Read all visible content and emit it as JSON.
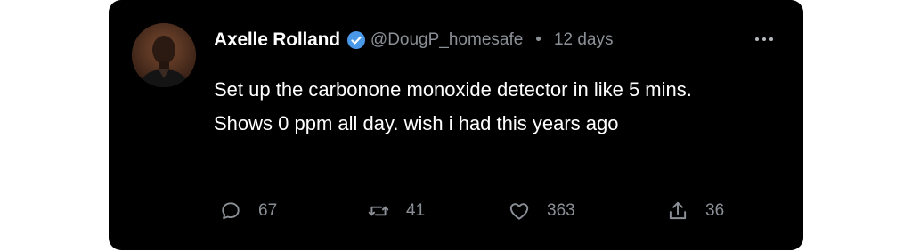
{
  "post": {
    "author_name": "Axelle Rolland",
    "handle": "@DougP_homesafe",
    "separator": "•",
    "time": "12 days",
    "text": "Set up the carbonone monoxide detector in like 5 mins. Shows 0 ppm all day. wish i had this years ago",
    "verified_color": "#4a99e9"
  },
  "actions": {
    "replies": "67",
    "reposts": "41",
    "likes": "363",
    "shares": "36"
  },
  "icons": [
    "avatar",
    "verified-badge-icon",
    "more-options-icon",
    "reply-icon",
    "repost-icon",
    "like-icon",
    "share-icon"
  ]
}
